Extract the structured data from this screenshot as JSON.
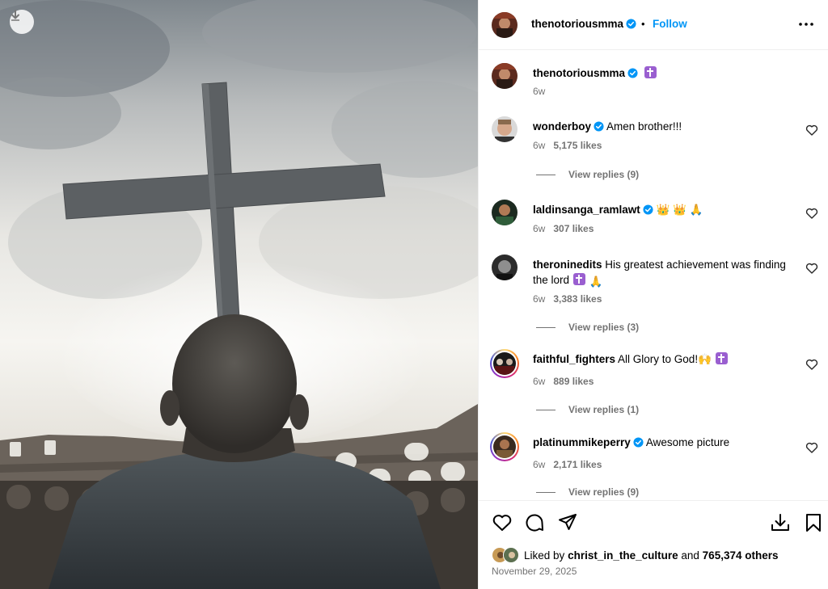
{
  "post": {
    "author": "thenotoriousmma",
    "follow_label": "Follow",
    "separator": "•",
    "caption_time": "6w"
  },
  "comments": [
    {
      "user": "wonderboy",
      "verified": true,
      "text": "Amen brother!!!",
      "time": "6w",
      "likes": "5,175 likes",
      "replies": "View replies (9)"
    },
    {
      "user": "laldinsanga_ramlawt",
      "verified": true,
      "text": "👑 👑 🙏",
      "time": "6w",
      "likes": "307 likes"
    },
    {
      "user": "theroninedits",
      "verified": false,
      "text": "His greatest achievement was finding the lord",
      "time": "6w",
      "likes": "3,383 likes",
      "replies": "View replies (3)"
    },
    {
      "user": "faithful_fighters",
      "verified": false,
      "text": "All Glory to God!🙌",
      "time": "6w",
      "likes": "889 likes",
      "replies": "View replies (1)"
    },
    {
      "user": "platinummikeperry",
      "verified": true,
      "text": "Awesome picture",
      "time": "6w",
      "likes": "2,171 likes",
      "replies": "View replies (9)"
    }
  ],
  "footer": {
    "liked_prefix": "Liked by",
    "liked_user": "christ_in_the_culture",
    "liked_and": "and",
    "liked_count": "765,374 others",
    "date": "November 29, 2025"
  },
  "icons": {
    "download": "download-icon",
    "verified": "verified-badge-icon",
    "more": "more-options-icon",
    "like": "heart-icon",
    "comment": "comment-icon",
    "share": "share-icon",
    "save": "bookmark-icon"
  },
  "colors": {
    "accent": "#0095f6",
    "secondary_text": "#737373",
    "verified": "#0095f6",
    "cross_badge": "#9a5fd0"
  }
}
